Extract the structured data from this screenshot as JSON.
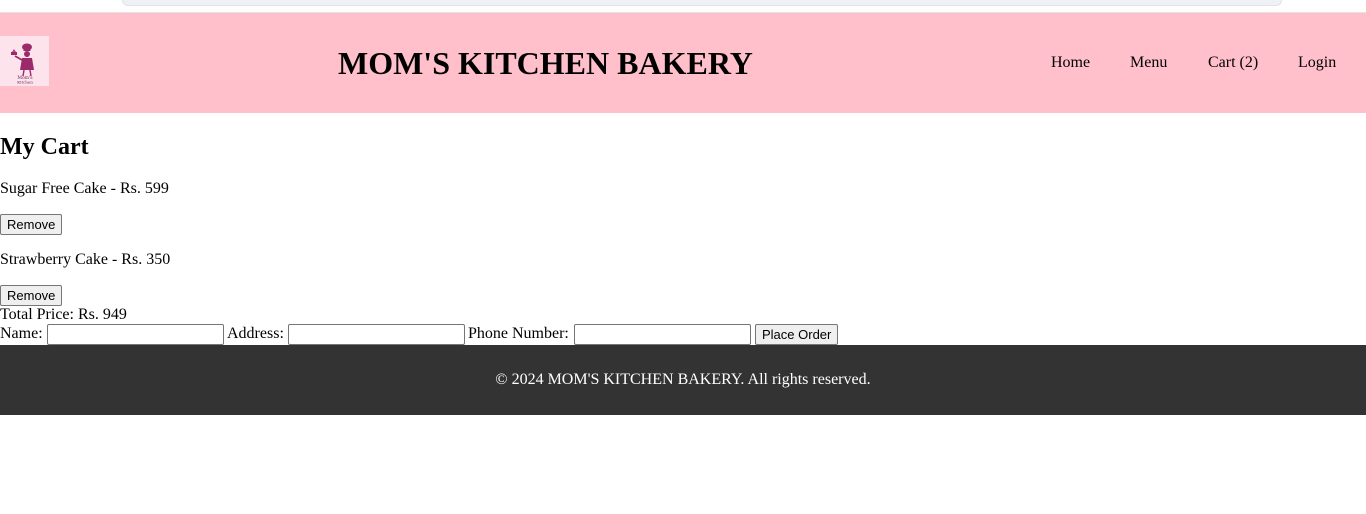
{
  "header": {
    "title": "MOM'S KITCHEN BAKERY",
    "logo_text": "Mom's Kitchen",
    "nav": [
      {
        "label": "Home"
      },
      {
        "label": "Menu"
      },
      {
        "label": "Cart (2)"
      },
      {
        "label": "Login"
      }
    ]
  },
  "cart": {
    "title": "My Cart",
    "items": [
      {
        "text": "Sugar Free Cake - Rs. 599",
        "remove_label": "Remove"
      },
      {
        "text": "Strawberry Cake - Rs. 350",
        "remove_label": "Remove"
      }
    ],
    "total": "Total Price: Rs. 949"
  },
  "order_form": {
    "name_label": "Name:",
    "name_value": "",
    "address_label": "Address:",
    "address_value": "",
    "phone_label": "Phone Number:",
    "phone_value": "",
    "submit_label": "Place Order"
  },
  "footer": {
    "text": "© 2024 MOM'S KITCHEN BAKERY. All rights reserved."
  },
  "colors": {
    "header_bg": "#ffc0cb",
    "footer_bg": "#333333",
    "logo_accent": "#9b2a6b"
  }
}
